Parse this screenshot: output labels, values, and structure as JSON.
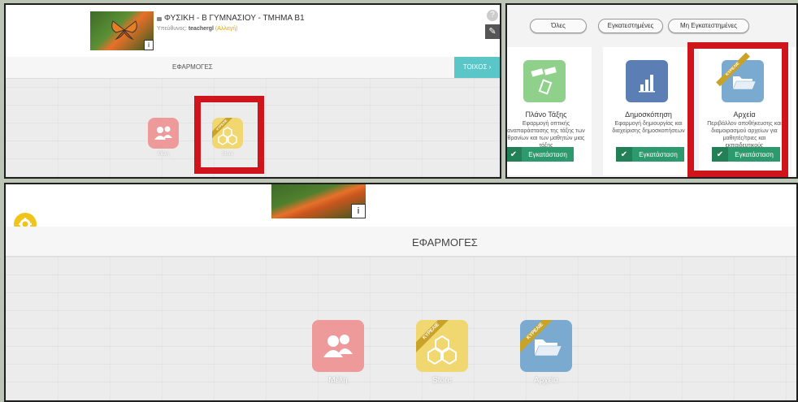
{
  "panel_top_left": {
    "class_title": "ΦΥΣΙΚΗ - Β ΓΥΜΝΑΣΙΟΥ - ΤΜΗΜΑ Β1",
    "owner_prefix": "Υπεύθυνος: ",
    "owner_name": "teachergl",
    "owner_change": "(Αλλαγή)",
    "info_label": "i",
    "help_label": "?",
    "edit_label": "✎",
    "section_title": "ΕΦΑΡΜΟΓΕΣ",
    "wall_button": "ΤΟΙΧΟΣ ›",
    "apps": [
      {
        "label": "Μέλη"
      },
      {
        "label": "Store",
        "ribbon": "ΚΥΡΕΛΙΕ"
      }
    ]
  },
  "panel_top_right": {
    "filters": [
      "Όλες",
      "Εγκατεστημένες",
      "Μη Εγκατεστημένες"
    ],
    "cards": [
      {
        "title": "Πλάνο Τάξης",
        "description": "Εφαρμογή οπτικής αναπαράστασης της τάξης των θρανίων και των μαθητών μιας τάξης",
        "button": "Εγκατάσταση",
        "check": "✔"
      },
      {
        "title": "Δημοσκόπηση",
        "description": "Εφαρμογή δημιουργίας και διαχείρισης δημοσκοπήσεων",
        "button": "Εγκατάσταση",
        "check": "✔"
      },
      {
        "title": "Αρχεία",
        "description": "Περιβάλλον αποθήκευσης και διαμοιρασμού αρχείων για μαθητές/τριες και εκπαιδευτικούς",
        "button": "Εγκατάσταση",
        "check": "✔",
        "ribbon": "ΚΥΡΕΛΙΕ"
      }
    ]
  },
  "panel_bottom": {
    "info_label": "i",
    "section_title": "ΕΦΑΡΜΟΓΕΣ",
    "apps": [
      {
        "label": "Μέλη"
      },
      {
        "label": "Store",
        "ribbon": "ΚΥΡΕΛΙΕ"
      },
      {
        "label": "Αρχεία",
        "ribbon": "ΚΥΡΕΛΙΕ"
      }
    ]
  },
  "colors": {
    "members": "#ee9a9a",
    "store": "#f0d770",
    "files": "#7aaad0",
    "plan": "#8fd08a",
    "poll": "#5b7fb4",
    "install": "#2d9a6d",
    "highlight": "#d0141c",
    "teal": "#5ac6c8",
    "gear": "#f0c419"
  },
  "icons": {
    "members": "users-icon",
    "store": "honeycomb-icon",
    "files": "folder-icon",
    "plan": "seat-plan-icon",
    "poll": "bar-chart-icon",
    "settings": "gear-icon",
    "lock": "lock-icon"
  }
}
